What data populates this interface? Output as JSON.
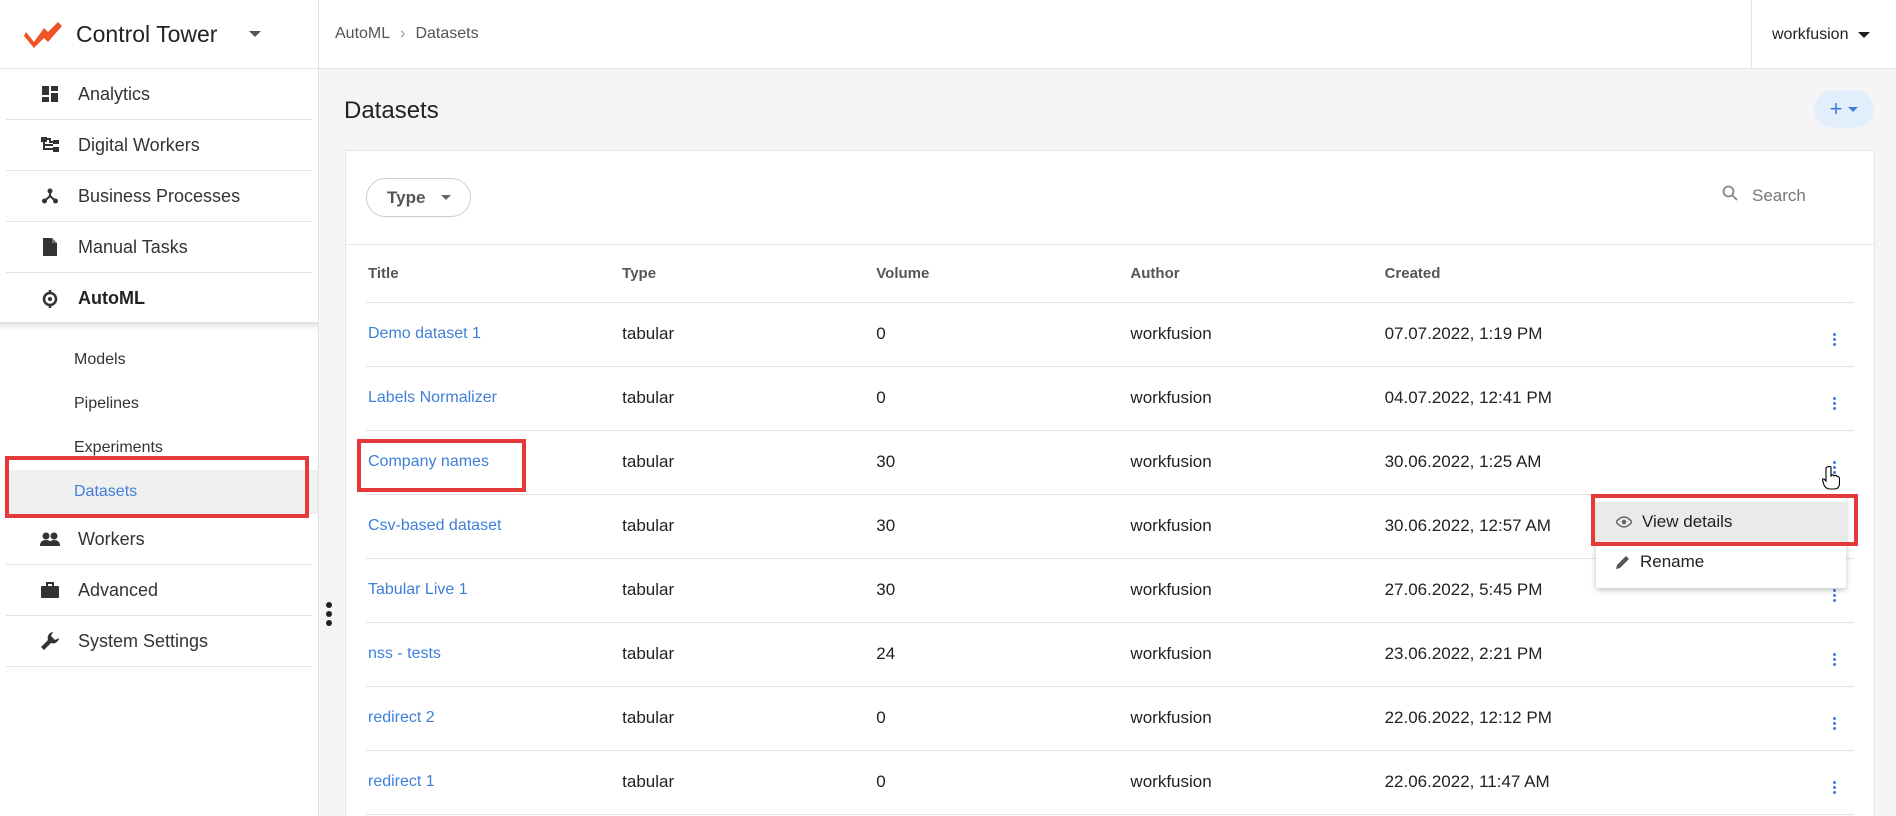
{
  "app": {
    "title": "Control Tower"
  },
  "breadcrumb": {
    "root": "AutoML",
    "current": "Datasets"
  },
  "user": {
    "name": "workfusion"
  },
  "sidebar": {
    "items": [
      {
        "label": "Analytics",
        "icon": "dashboard-icon"
      },
      {
        "label": "Digital Workers",
        "icon": "hierarchy-icon"
      },
      {
        "label": "Business Processes",
        "icon": "process-icon"
      },
      {
        "label": "Manual Tasks",
        "icon": "document-icon"
      },
      {
        "label": "AutoML",
        "icon": "automl-icon"
      }
    ],
    "sub_items": [
      "Models",
      "Pipelines",
      "Experiments",
      "Datasets"
    ],
    "bottom_items": [
      {
        "label": "Workers",
        "icon": "people-icon"
      },
      {
        "label": "Advanced",
        "icon": "briefcase-icon"
      },
      {
        "label": "System Settings",
        "icon": "wrench-icon"
      }
    ]
  },
  "page": {
    "title": "Datasets",
    "add_label": "+"
  },
  "filters": {
    "type_label": "Type",
    "search_placeholder": "Search"
  },
  "table": {
    "headers": [
      "Title",
      "Type",
      "Volume",
      "Author",
      "Created"
    ],
    "rows": [
      [
        "Demo dataset 1",
        "tabular",
        "0",
        "workfusion",
        "07.07.2022, 1:19 PM"
      ],
      [
        "Labels Normalizer",
        "tabular",
        "0",
        "workfusion",
        "04.07.2022, 12:41 PM"
      ],
      [
        "Company names",
        "tabular",
        "30",
        "workfusion",
        "30.06.2022, 1:25 AM"
      ],
      [
        "Csv-based dataset",
        "tabular",
        "30",
        "workfusion",
        "30.06.2022, 12:57 AM"
      ],
      [
        "Tabular Live 1",
        "tabular",
        "30",
        "workfusion",
        "27.06.2022, 5:45 PM"
      ],
      [
        "nss - tests",
        "tabular",
        "24",
        "workfusion",
        "23.06.2022, 2:21 PM"
      ],
      [
        "redirect 2",
        "tabular",
        "0",
        "workfusion",
        "22.06.2022, 12:12 PM"
      ],
      [
        "redirect 1",
        "tabular",
        "0",
        "workfusion",
        "22.06.2022, 11:47 AM"
      ]
    ]
  },
  "context_menu": {
    "view_details": "View details",
    "rename": "Rename"
  },
  "colors": {
    "accent": "#3f7fd9",
    "highlight": "#e5393b",
    "brand": "#ef5323"
  }
}
